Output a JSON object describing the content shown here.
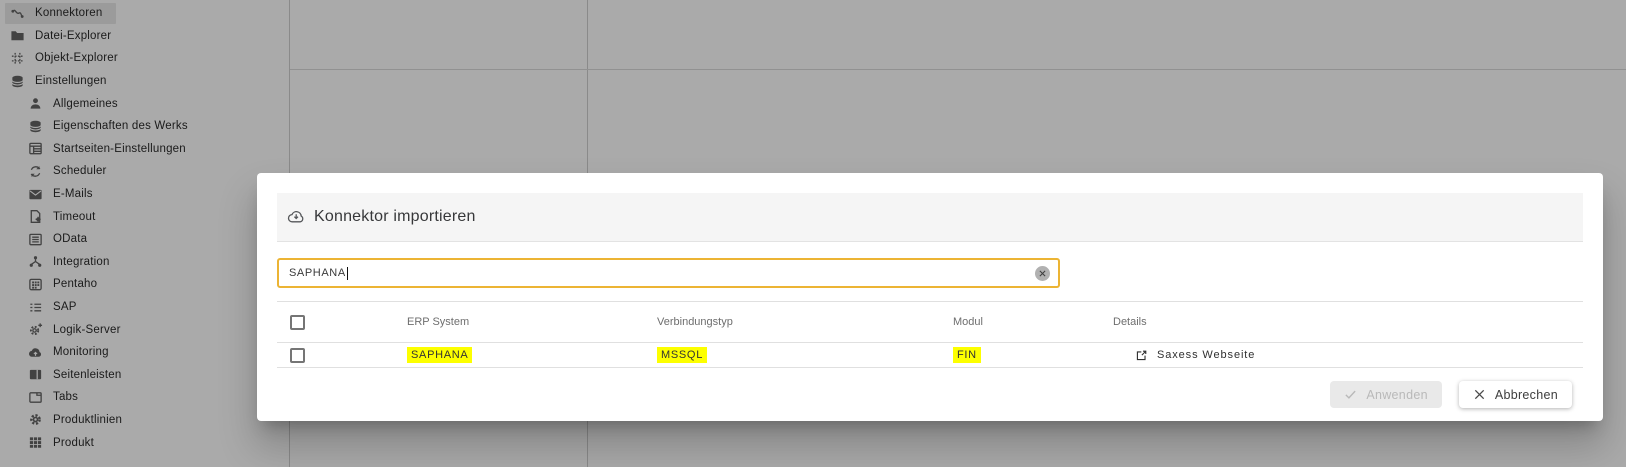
{
  "sidebar": {
    "items": [
      {
        "label": "Konnektoren",
        "icon": "connector-icon",
        "level": 0,
        "selected": true
      },
      {
        "label": "Datei-Explorer",
        "icon": "folder-icon",
        "level": 0,
        "selected": false
      },
      {
        "label": "Objekt-Explorer",
        "icon": "object-grid-icon",
        "level": 0,
        "selected": false
      },
      {
        "label": "Einstellungen",
        "icon": "database-icon",
        "level": 0,
        "selected": false
      },
      {
        "label": "Allgemeines",
        "icon": "person-icon",
        "level": 1,
        "selected": false
      },
      {
        "label": "Eigenschaften des Werks",
        "icon": "database-icon",
        "level": 1,
        "selected": false
      },
      {
        "label": "Startseiten-Einstellungen",
        "icon": "table-settings-icon",
        "level": 1,
        "selected": false
      },
      {
        "label": "Scheduler",
        "icon": "sync-icon",
        "level": 1,
        "selected": false
      },
      {
        "label": "E-Mails",
        "icon": "email-icon",
        "level": 1,
        "selected": false
      },
      {
        "label": "Timeout",
        "icon": "document-gear-icon",
        "level": 1,
        "selected": false
      },
      {
        "label": "OData",
        "icon": "list-box-icon",
        "level": 1,
        "selected": false
      },
      {
        "label": "Integration",
        "icon": "branch-icon",
        "level": 1,
        "selected": false
      },
      {
        "label": "Pentaho",
        "icon": "keypad-icon",
        "level": 1,
        "selected": false
      },
      {
        "label": "SAP",
        "icon": "list-icon",
        "level": 1,
        "selected": false
      },
      {
        "label": "Logik-Server",
        "icon": "gear-plus-icon",
        "level": 1,
        "selected": false
      },
      {
        "label": "Monitoring",
        "icon": "cloud-upload-icon",
        "level": 1,
        "selected": false
      },
      {
        "label": "Seitenleisten",
        "icon": "sidebar-layout-icon",
        "level": 1,
        "selected": false
      },
      {
        "label": "Tabs",
        "icon": "tab-icon",
        "level": 1,
        "selected": false
      },
      {
        "label": "Produktlinien",
        "icon": "gear-icon",
        "level": 1,
        "selected": false
      },
      {
        "label": "Produkt",
        "icon": "grid-icon",
        "level": 1,
        "selected": false
      }
    ]
  },
  "modal": {
    "title": "Konnektor importieren",
    "title_icon": "cloud-download-icon",
    "search": {
      "value": "SAPHANA",
      "clear_icon": "clear-circle-icon"
    },
    "table": {
      "columns": [
        "ERP System",
        "Verbindungstyp",
        "Modul",
        "Details"
      ],
      "rows": [
        {
          "erp_system": "SAPHANA",
          "verbindungstyp": "MSSQL",
          "modul": "FIN",
          "details": "Saxess Webseite",
          "details_icon": "external-link-icon",
          "highlighted": true,
          "checked": false
        }
      ]
    },
    "buttons": {
      "apply": "Anwenden",
      "apply_disabled": true,
      "cancel": "Abbrechen"
    }
  },
  "colors": {
    "highlight": "#fdff00",
    "search_border": "#ecb434",
    "header_band": "#f5f5f5",
    "selected_item_bg": "#e9e9e9"
  }
}
